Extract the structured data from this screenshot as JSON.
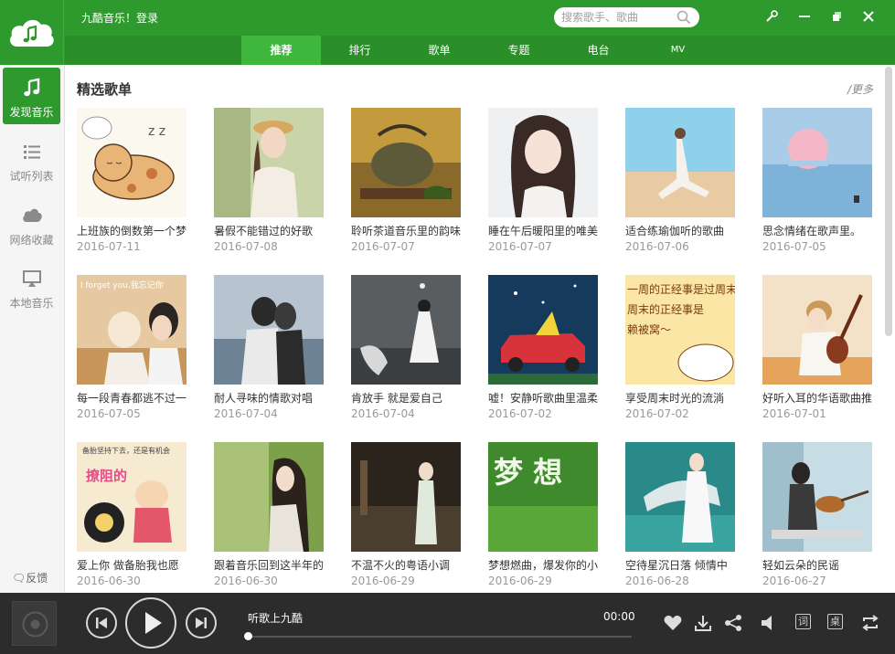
{
  "header": {
    "app_title": "九酷音乐！登录",
    "search_placeholder": "搜索歌手、歌曲",
    "tabs": [
      {
        "label": "推荐",
        "active": true
      },
      {
        "label": "排行"
      },
      {
        "label": "歌单"
      },
      {
        "label": "专题"
      },
      {
        "label": "电台"
      },
      {
        "label": "MV"
      }
    ],
    "window_controls": [
      "settings-icon",
      "minimize-icon",
      "restore-icon",
      "close-icon"
    ]
  },
  "sidebar": {
    "items": [
      {
        "label": "发现音乐",
        "icon": "music-note-icon",
        "active": true
      },
      {
        "label": "试听列表",
        "icon": "list-icon"
      },
      {
        "label": "网络收藏",
        "icon": "cloud-icon"
      },
      {
        "label": "本地音乐",
        "icon": "monitor-icon"
      }
    ],
    "feedback_label": "反馈"
  },
  "main": {
    "section_title": "精选歌单",
    "more_label": "更多",
    "playlists": [
      {
        "title": "上班族的倒数第一个梦",
        "date": "2016-07-11"
      },
      {
        "title": "暑假不能错过的好歌",
        "date": "2016-07-08"
      },
      {
        "title": "聆听茶道音乐里的韵味",
        "date": "2016-07-07"
      },
      {
        "title": "睡在午后暖阳里的唯美",
        "date": "2016-07-07"
      },
      {
        "title": "适合练瑜伽听的歌曲",
        "date": "2016-07-06"
      },
      {
        "title": "思念情绪在歌声里。",
        "date": "2016-07-05"
      },
      {
        "title": "每一段青春都逃不过一",
        "date": "2016-07-05"
      },
      {
        "title": "耐人寻味的情歌对唱",
        "date": "2016-07-04"
      },
      {
        "title": "肯放手 就是爱自己",
        "date": "2016-07-04"
      },
      {
        "title": "嘘！安静听歌曲里温柔",
        "date": "2016-07-02"
      },
      {
        "title": "享受周末时光的流淌",
        "date": "2016-07-02"
      },
      {
        "title": "好听入耳的华语歌曲推",
        "date": "2016-07-01"
      },
      {
        "title": "爱上你 做备胎我也愿",
        "date": "2016-06-30"
      },
      {
        "title": "跟着音乐回到这半年的",
        "date": "2016-06-30"
      },
      {
        "title": "不温不火的粤语小调",
        "date": "2016-06-29"
      },
      {
        "title": "梦想燃曲，爆发你的小",
        "date": "2016-06-29"
      },
      {
        "title": "空待星沉日落 倾情中",
        "date": "2016-06-28"
      },
      {
        "title": "轻如云朵的民谣",
        "date": "2016-06-27"
      }
    ],
    "cover_texts": {
      "c7": "I forget you.我忘记你",
      "c11_lines": [
        "一周的正经事是过周末",
        "周末的正经事是",
        "赖被窝～"
      ],
      "c13_top": "备胎坚持下去，还是有机会",
      "c13_main": "撩阻的",
      "c16": "梦 想"
    }
  },
  "player": {
    "song_title": "听歌上九酷",
    "time": "00:00",
    "progress": 0,
    "lyric_button": "词",
    "desktop_button": "桌"
  },
  "colors": {
    "brand_green": "#2e9a2d",
    "nav_green": "#2a8f29",
    "active_tab": "#3fb63c",
    "player_bg": "#2c2c2c"
  }
}
